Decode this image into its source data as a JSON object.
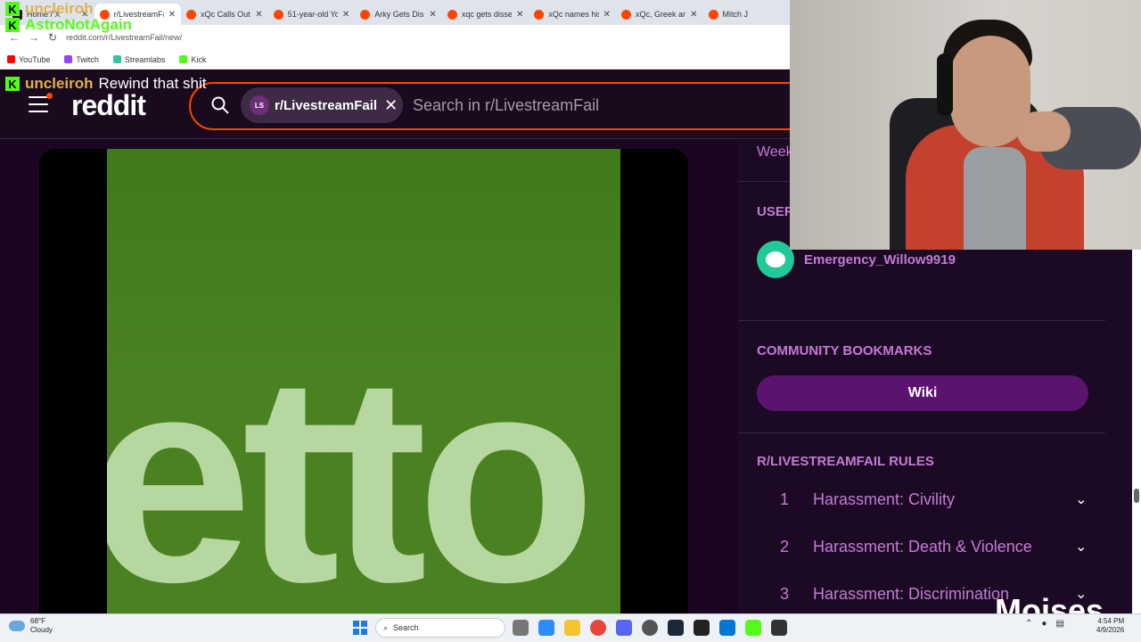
{
  "browser": {
    "tabs": [
      {
        "label": "Home / X",
        "icon": "x-icon",
        "active": false
      },
      {
        "label": "r/LivestreamFail",
        "icon": "reddit-icon",
        "active": true
      },
      {
        "label": "xQc Calls Out C",
        "icon": "reddit-icon",
        "active": false
      },
      {
        "label": "51-year-old You",
        "icon": "reddit-icon",
        "active": false
      },
      {
        "label": "Arky Gets Disse",
        "icon": "reddit-icon",
        "active": false
      },
      {
        "label": "xqc gets dissed",
        "icon": "reddit-icon",
        "active": false
      },
      {
        "label": "xQc names his s",
        "icon": "reddit-icon",
        "active": false
      },
      {
        "label": "xQc, Greek and",
        "icon": "reddit-icon",
        "active": false
      },
      {
        "label": "Mitch J",
        "icon": "reddit-icon",
        "active": false
      }
    ],
    "url": "reddit.com/r/LivestreamFail/new/",
    "bookmarks": [
      "YouTube",
      "Twitch",
      "Streamlabs",
      "Kick"
    ]
  },
  "chat": [
    {
      "user": "uncleiroh",
      "message": ""
    },
    {
      "user": "AstroNotAgain",
      "message": ""
    },
    {
      "user": "uncleiroh",
      "message": "Rewind that shit"
    }
  ],
  "reddit": {
    "logo": "reddit",
    "search_chip": "r/LivestreamFail",
    "chip_avatar": "LS",
    "search_placeholder": "Search in r/LivestreamFail",
    "post_media_text": "etto"
  },
  "sidebar": {
    "weekly_label": "Week",
    "user_section": "USER",
    "user_name": "Emergency_Willow9919",
    "bookmarks_title": "COMMUNITY BOOKMARKS",
    "wiki_label": "Wiki",
    "rules_title": "R/LIVESTREAMFAIL RULES",
    "rules": [
      {
        "num": "1",
        "label": "Harassment: Civility"
      },
      {
        "num": "2",
        "label": "Harassment: Death & Violence"
      },
      {
        "num": "3",
        "label": "Harassment: Discrimination"
      }
    ]
  },
  "watermark": "Moises",
  "taskbar": {
    "weather_temp": "68°F",
    "weather_desc": "Cloudy",
    "search_label": "Search",
    "time": "4:54 PM",
    "date": "4/9/2026"
  },
  "colors": {
    "reddit_orange": "#ff4500",
    "sidebar_accent": "#c47ad6",
    "wiki_button": "#5b1370",
    "kick_green": "#53fc18"
  }
}
